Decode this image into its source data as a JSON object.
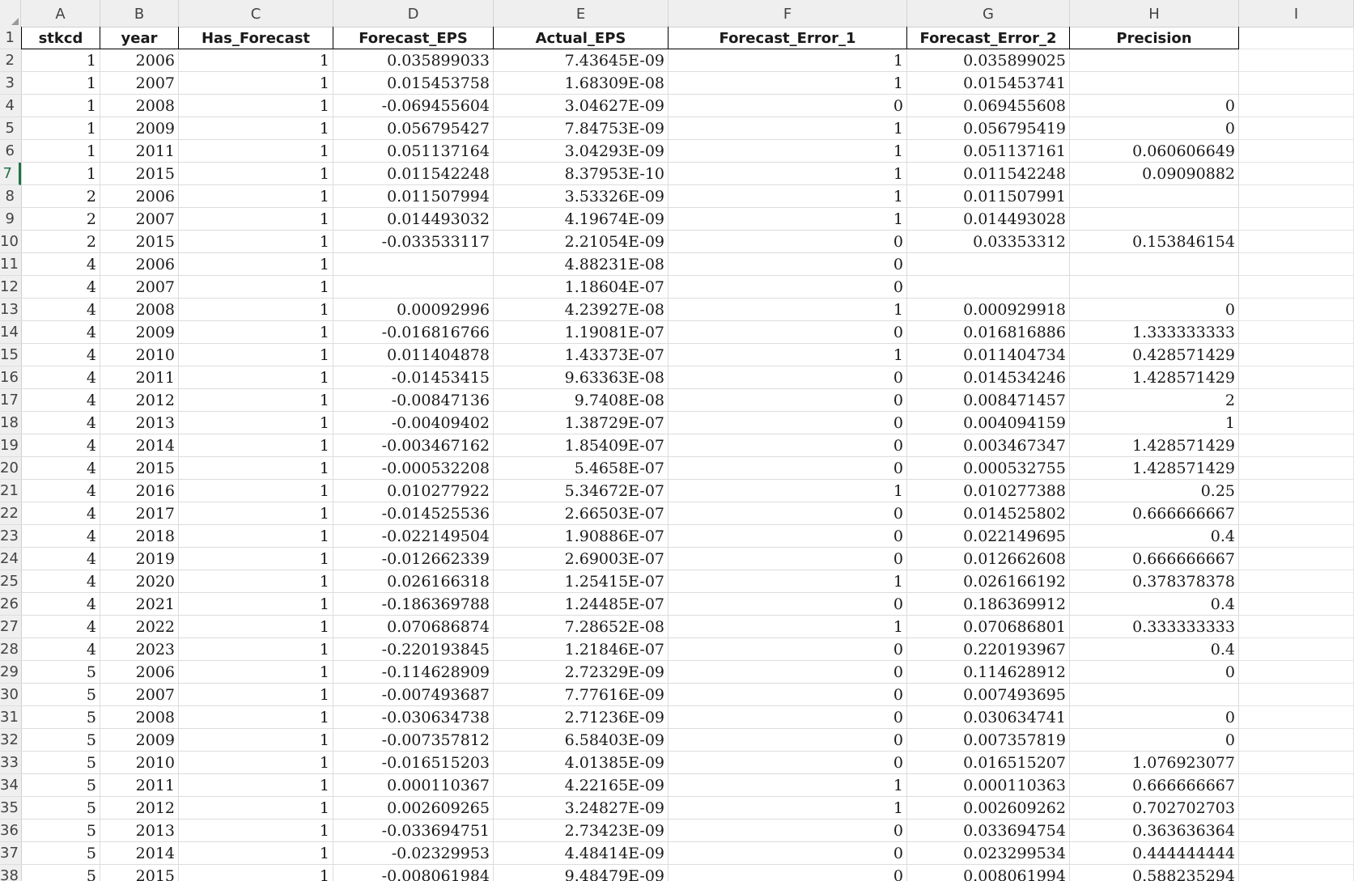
{
  "sheet": {
    "columns": [
      "A",
      "B",
      "C",
      "D",
      "E",
      "F",
      "G",
      "H",
      "I"
    ],
    "row_numbers": [
      "1",
      "2",
      "3",
      "4",
      "5",
      "6",
      "7",
      "8",
      "9",
      "10",
      "11",
      "12",
      "13",
      "14",
      "15",
      "16",
      "17",
      "18",
      "19",
      "20",
      "21",
      "22",
      "23",
      "24",
      "25",
      "26",
      "27",
      "28",
      "29",
      "30",
      "31",
      "32",
      "33",
      "34",
      "35",
      "36",
      "37",
      "38"
    ],
    "selected_row_index": 6,
    "headers": [
      "stkcd",
      "year",
      "Has_Forecast",
      "Forecast_EPS",
      "Actual_EPS",
      "Forecast_Error_1",
      "Forecast_Error_2",
      "Precision"
    ],
    "rows": [
      [
        "1",
        "2006",
        "1",
        "0.035899033",
        "7.43645E-09",
        "1",
        "0.035899025",
        ""
      ],
      [
        "1",
        "2007",
        "1",
        "0.015453758",
        "1.68309E-08",
        "1",
        "0.015453741",
        ""
      ],
      [
        "1",
        "2008",
        "1",
        "-0.069455604",
        "3.04627E-09",
        "0",
        "0.069455608",
        "0"
      ],
      [
        "1",
        "2009",
        "1",
        "0.056795427",
        "7.84753E-09",
        "1",
        "0.056795419",
        "0"
      ],
      [
        "1",
        "2011",
        "1",
        "0.051137164",
        "3.04293E-09",
        "1",
        "0.051137161",
        "0.060606649"
      ],
      [
        "1",
        "2015",
        "1",
        "0.011542248",
        "8.37953E-10",
        "1",
        "0.011542248",
        "0.09090882"
      ],
      [
        "2",
        "2006",
        "1",
        "0.011507994",
        "3.53326E-09",
        "1",
        "0.011507991",
        ""
      ],
      [
        "2",
        "2007",
        "1",
        "0.014493032",
        "4.19674E-09",
        "1",
        "0.014493028",
        ""
      ],
      [
        "2",
        "2015",
        "1",
        "-0.033533117",
        "2.21054E-09",
        "0",
        "0.03353312",
        "0.153846154"
      ],
      [
        "4",
        "2006",
        "1",
        "",
        "4.88231E-08",
        "0",
        "",
        ""
      ],
      [
        "4",
        "2007",
        "1",
        "",
        "1.18604E-07",
        "0",
        "",
        ""
      ],
      [
        "4",
        "2008",
        "1",
        "0.00092996",
        "4.23927E-08",
        "1",
        "0.000929918",
        "0"
      ],
      [
        "4",
        "2009",
        "1",
        "-0.016816766",
        "1.19081E-07",
        "0",
        "0.016816886",
        "1.333333333"
      ],
      [
        "4",
        "2010",
        "1",
        "0.011404878",
        "1.43373E-07",
        "1",
        "0.011404734",
        "0.428571429"
      ],
      [
        "4",
        "2011",
        "1",
        "-0.01453415",
        "9.63363E-08",
        "0",
        "0.014534246",
        "1.428571429"
      ],
      [
        "4",
        "2012",
        "1",
        "-0.00847136",
        "9.7408E-08",
        "0",
        "0.008471457",
        "2"
      ],
      [
        "4",
        "2013",
        "1",
        "-0.00409402",
        "1.38729E-07",
        "0",
        "0.004094159",
        "1"
      ],
      [
        "4",
        "2014",
        "1",
        "-0.003467162",
        "1.85409E-07",
        "0",
        "0.003467347",
        "1.428571429"
      ],
      [
        "4",
        "2015",
        "1",
        "-0.000532208",
        "5.4658E-07",
        "0",
        "0.000532755",
        "1.428571429"
      ],
      [
        "4",
        "2016",
        "1",
        "0.010277922",
        "5.34672E-07",
        "1",
        "0.010277388",
        "0.25"
      ],
      [
        "4",
        "2017",
        "1",
        "-0.014525536",
        "2.66503E-07",
        "0",
        "0.014525802",
        "0.666666667"
      ],
      [
        "4",
        "2018",
        "1",
        "-0.022149504",
        "1.90886E-07",
        "0",
        "0.022149695",
        "0.4"
      ],
      [
        "4",
        "2019",
        "1",
        "-0.012662339",
        "2.69003E-07",
        "0",
        "0.012662608",
        "0.666666667"
      ],
      [
        "4",
        "2020",
        "1",
        "0.026166318",
        "1.25415E-07",
        "1",
        "0.026166192",
        "0.378378378"
      ],
      [
        "4",
        "2021",
        "1",
        "-0.186369788",
        "1.24485E-07",
        "0",
        "0.186369912",
        "0.4"
      ],
      [
        "4",
        "2022",
        "1",
        "0.070686874",
        "7.28652E-08",
        "1",
        "0.070686801",
        "0.333333333"
      ],
      [
        "4",
        "2023",
        "1",
        "-0.220193845",
        "1.21846E-07",
        "0",
        "0.220193967",
        "0.4"
      ],
      [
        "5",
        "2006",
        "1",
        "-0.114628909",
        "2.72329E-09",
        "0",
        "0.114628912",
        "0"
      ],
      [
        "5",
        "2007",
        "1",
        "-0.007493687",
        "7.77616E-09",
        "0",
        "0.007493695",
        ""
      ],
      [
        "5",
        "2008",
        "1",
        "-0.030634738",
        "2.71236E-09",
        "0",
        "0.030634741",
        "0"
      ],
      [
        "5",
        "2009",
        "1",
        "-0.007357812",
        "6.58403E-09",
        "0",
        "0.007357819",
        "0"
      ],
      [
        "5",
        "2010",
        "1",
        "-0.016515203",
        "4.01385E-09",
        "0",
        "0.016515207",
        "1.076923077"
      ],
      [
        "5",
        "2011",
        "1",
        "0.000110367",
        "4.22165E-09",
        "1",
        "0.000110363",
        "0.666666667"
      ],
      [
        "5",
        "2012",
        "1",
        "0.002609265",
        "3.24827E-09",
        "1",
        "0.002609262",
        "0.702702703"
      ],
      [
        "5",
        "2013",
        "1",
        "-0.033694751",
        "2.73423E-09",
        "0",
        "0.033694754",
        "0.363636364"
      ],
      [
        "5",
        "2014",
        "1",
        "-0.02329953",
        "4.48414E-09",
        "0",
        "0.023299534",
        "0.444444444"
      ],
      [
        "5",
        "2015",
        "1",
        "-0.008061984",
        "9.48479E-09",
        "0",
        "0.008061994",
        "0.588235294"
      ]
    ]
  }
}
